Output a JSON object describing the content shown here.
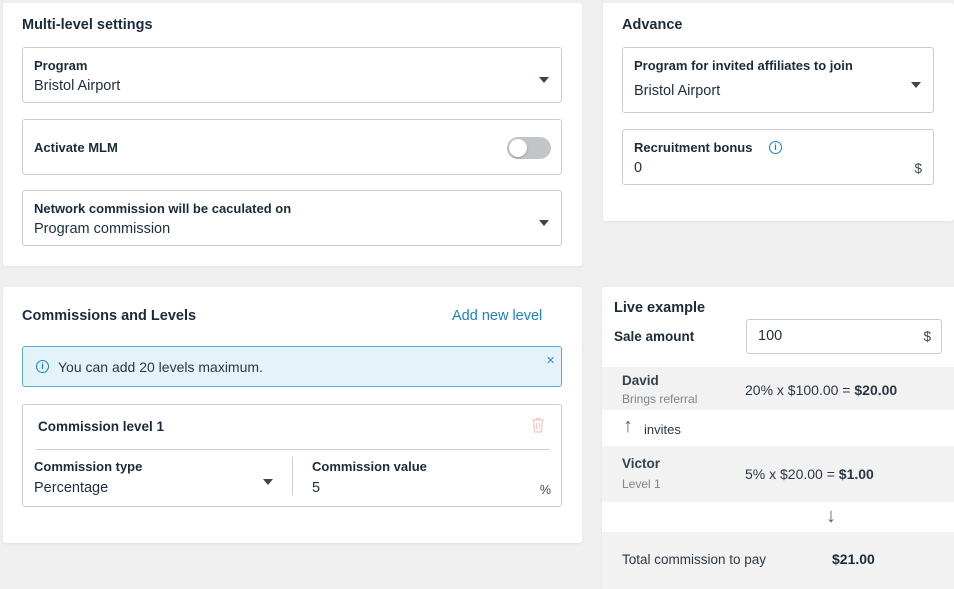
{
  "multilevel": {
    "title": "Multi-level settings",
    "program_label": "Program",
    "program_value": "Bristol Airport",
    "activate_label": "Activate MLM",
    "activate_on": false,
    "network_label": "Network commission will be caculated on",
    "network_value": "Program commission"
  },
  "advance": {
    "title": "Advance",
    "program_label": "Program for invited affiliates to join",
    "program_value": "Bristol Airport",
    "bonus_label": "Recruitment bonus",
    "bonus_value": "0",
    "bonus_unit": "$"
  },
  "commissions": {
    "title": "Commissions and Levels",
    "add_level": "Add new level",
    "alert_text": "You can add 20 levels maximum.",
    "levels": [
      {
        "title": "Commission level 1",
        "type_label": "Commission type",
        "type_value": "Percentage",
        "value_label": "Commission value",
        "value": "5",
        "value_unit": "%"
      }
    ]
  },
  "live": {
    "title": "Live example",
    "sale_label": "Sale amount",
    "sale_value": "100",
    "sale_unit": "$",
    "rows": [
      {
        "name": "David",
        "sub": "Brings referral",
        "calc": "20% x $100.00 = ",
        "result": "$20.00"
      },
      {
        "name": "Victor",
        "sub": "Level 1",
        "calc": "5% x $20.00 = ",
        "result": "$1.00"
      }
    ],
    "invites_label": "invites",
    "total_label": "Total commission to pay",
    "total_value": "$21.00"
  },
  "colors": {
    "accent": "#1f7fc2",
    "alert_bg": "#e4f3fa",
    "text": "#1a2b3c"
  }
}
